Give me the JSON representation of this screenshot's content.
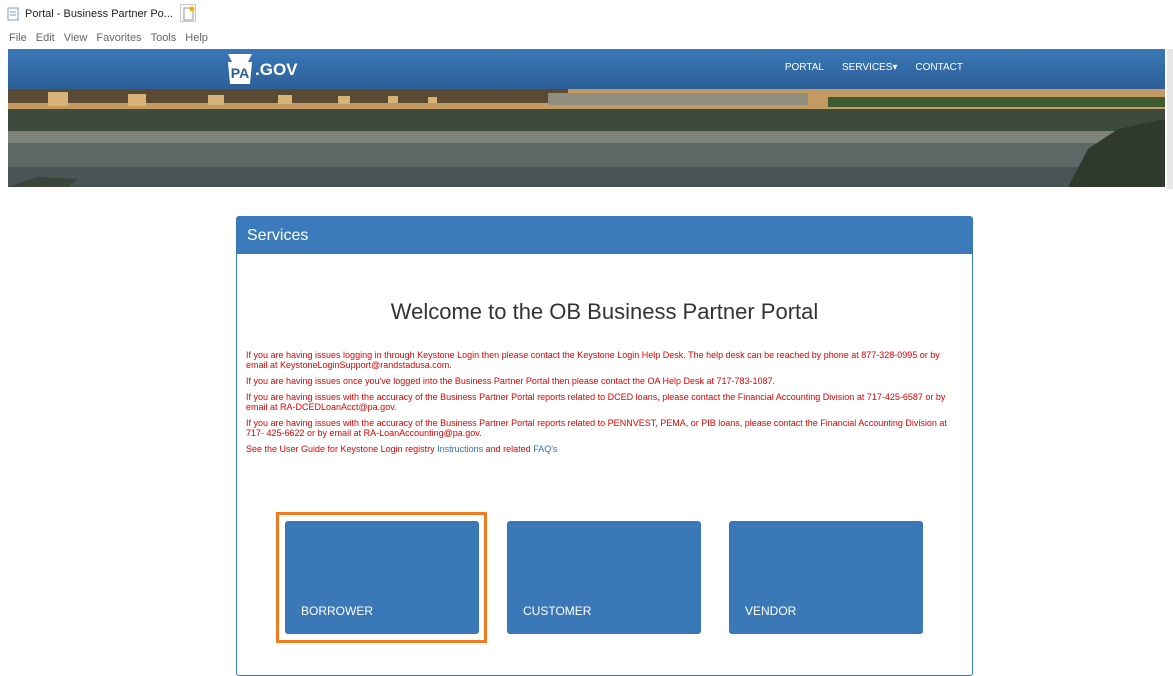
{
  "browser": {
    "tab_title": "Portal - Business Partner Po...",
    "tab_close": "×",
    "menu": [
      "File",
      "Edit",
      "View",
      "Favorites",
      "Tools",
      "Help"
    ]
  },
  "header": {
    "logo_pa": "PA",
    "logo_gov": ".GOV",
    "nav": [
      "PORTAL",
      "SERVICES▾",
      "CONTACT"
    ]
  },
  "panel": {
    "heading": "Services",
    "welcome": "Welcome to the OB Business Partner Portal",
    "notice1": "If you are having issues logging in through Keystone Login then please contact the Keystone Login Help Desk. The help desk can be reached by phone at 877-328-0995 or by email at KeystoneLoginSupport@randstadusa.com.",
    "notice2": "If you are having issues once you've logged into the Business Partner Portal then please contact the OA Help Desk at 717-783-1087.",
    "notice3": "If you are having issues with the accuracy of the Business Partner Portal reports related to DCED loans, please contact the Financial Accounting Division at 717-425-6587 or by email at RA-DCEDLoanAcct@pa.gov.",
    "notice4": "If you are having issues with the accuracy of the Business Partner Portal reports related to PENNVEST, PEMA, or PIB loans, please contact the Financial Accounting Division at 717- 425-6622 or by email at RA-LoanAccounting@pa.gov.",
    "guide_prefix": "See the User Guide for Keystone Login registry ",
    "guide_instructions": "Instructions",
    "guide_middle": " and related ",
    "guide_faq": "FAQ's"
  },
  "tiles": {
    "borrower": "BORROWER",
    "customer": "CUSTOMER",
    "vendor": "VENDOR"
  },
  "colors": {
    "accent": "#3b78b8",
    "notice": "#e00000",
    "highlight": "#f07c1f"
  }
}
